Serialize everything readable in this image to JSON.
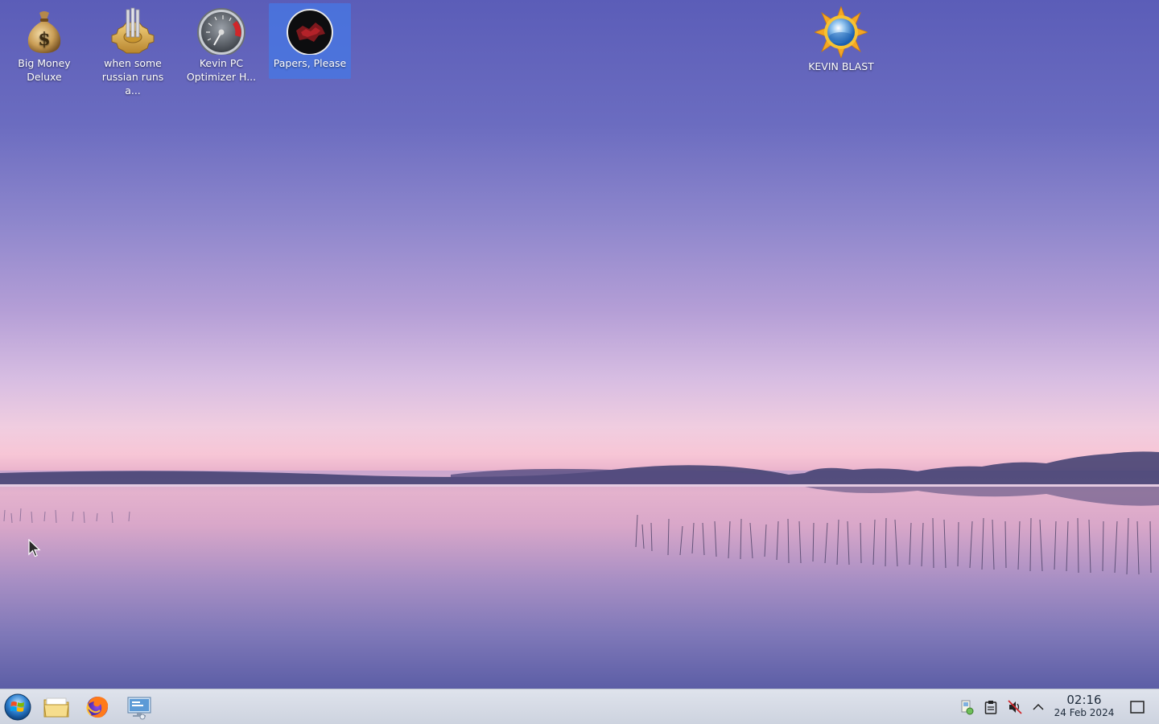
{
  "desktop": {
    "icons": [
      {
        "label": "Big Money Deluxe",
        "icon": "money-bag-icon"
      },
      {
        "label": "when some russian runs a...",
        "icon": "gear-icon"
      },
      {
        "label": "Kevin PC Optimizer H...",
        "icon": "speedometer-icon"
      },
      {
        "label": "Papers, Please",
        "icon": "papers-please-icon",
        "selected": true
      },
      {
        "label": "KEVIN BLAST",
        "icon": "sun-globe-icon"
      }
    ]
  },
  "taskbar": {
    "pinned": [
      {
        "name": "start-menu",
        "icon": "windows-orb-icon"
      },
      {
        "name": "file-explorer",
        "icon": "folder-icon"
      },
      {
        "name": "firefox",
        "icon": "firefox-icon"
      },
      {
        "name": "remote-desktop",
        "icon": "network-computer-icon"
      }
    ],
    "tray": [
      {
        "name": "network",
        "icon": "network-status-icon"
      },
      {
        "name": "clipboard",
        "icon": "clipboard-icon"
      },
      {
        "name": "volume",
        "icon": "volume-muted-icon"
      },
      {
        "name": "show-hidden",
        "icon": "chevron-up-icon"
      }
    ],
    "clock": {
      "time": "02:16",
      "date": "24 Feb 2024"
    },
    "show_desktop_icon": "show-desktop-icon"
  },
  "colors": {
    "selection": "#4678e6",
    "taskbar": "#d6dbe6",
    "sky_top": "#5b5db8",
    "sky_horizon": "#f7c6d6"
  }
}
